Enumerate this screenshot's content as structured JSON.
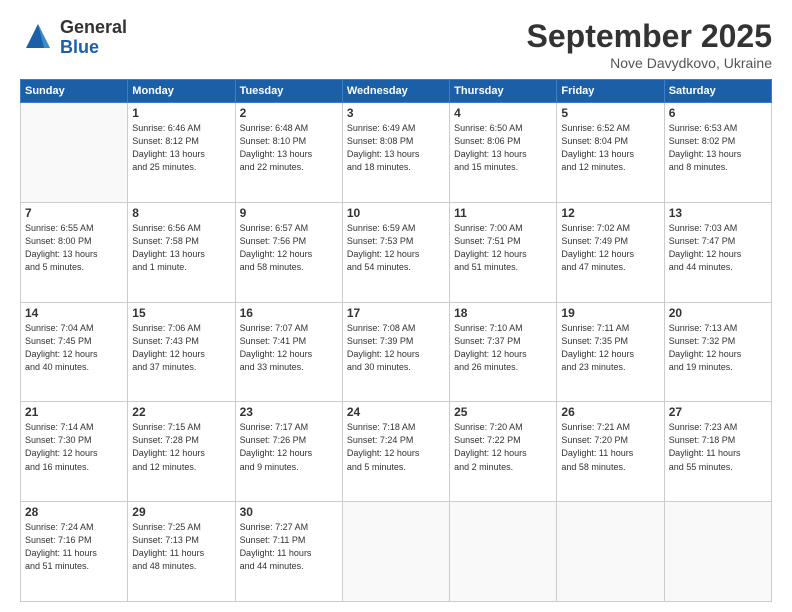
{
  "logo": {
    "general": "General",
    "blue": "Blue"
  },
  "header": {
    "month": "September 2025",
    "location": "Nove Davydkovo, Ukraine"
  },
  "weekdays": [
    "Sunday",
    "Monday",
    "Tuesday",
    "Wednesday",
    "Thursday",
    "Friday",
    "Saturday"
  ],
  "weeks": [
    [
      {
        "day": "",
        "info": ""
      },
      {
        "day": "1",
        "info": "Sunrise: 6:46 AM\nSunset: 8:12 PM\nDaylight: 13 hours\nand 25 minutes."
      },
      {
        "day": "2",
        "info": "Sunrise: 6:48 AM\nSunset: 8:10 PM\nDaylight: 13 hours\nand 22 minutes."
      },
      {
        "day": "3",
        "info": "Sunrise: 6:49 AM\nSunset: 8:08 PM\nDaylight: 13 hours\nand 18 minutes."
      },
      {
        "day": "4",
        "info": "Sunrise: 6:50 AM\nSunset: 8:06 PM\nDaylight: 13 hours\nand 15 minutes."
      },
      {
        "day": "5",
        "info": "Sunrise: 6:52 AM\nSunset: 8:04 PM\nDaylight: 13 hours\nand 12 minutes."
      },
      {
        "day": "6",
        "info": "Sunrise: 6:53 AM\nSunset: 8:02 PM\nDaylight: 13 hours\nand 8 minutes."
      }
    ],
    [
      {
        "day": "7",
        "info": "Sunrise: 6:55 AM\nSunset: 8:00 PM\nDaylight: 13 hours\nand 5 minutes."
      },
      {
        "day": "8",
        "info": "Sunrise: 6:56 AM\nSunset: 7:58 PM\nDaylight: 13 hours\nand 1 minute."
      },
      {
        "day": "9",
        "info": "Sunrise: 6:57 AM\nSunset: 7:56 PM\nDaylight: 12 hours\nand 58 minutes."
      },
      {
        "day": "10",
        "info": "Sunrise: 6:59 AM\nSunset: 7:53 PM\nDaylight: 12 hours\nand 54 minutes."
      },
      {
        "day": "11",
        "info": "Sunrise: 7:00 AM\nSunset: 7:51 PM\nDaylight: 12 hours\nand 51 minutes."
      },
      {
        "day": "12",
        "info": "Sunrise: 7:02 AM\nSunset: 7:49 PM\nDaylight: 12 hours\nand 47 minutes."
      },
      {
        "day": "13",
        "info": "Sunrise: 7:03 AM\nSunset: 7:47 PM\nDaylight: 12 hours\nand 44 minutes."
      }
    ],
    [
      {
        "day": "14",
        "info": "Sunrise: 7:04 AM\nSunset: 7:45 PM\nDaylight: 12 hours\nand 40 minutes."
      },
      {
        "day": "15",
        "info": "Sunrise: 7:06 AM\nSunset: 7:43 PM\nDaylight: 12 hours\nand 37 minutes."
      },
      {
        "day": "16",
        "info": "Sunrise: 7:07 AM\nSunset: 7:41 PM\nDaylight: 12 hours\nand 33 minutes."
      },
      {
        "day": "17",
        "info": "Sunrise: 7:08 AM\nSunset: 7:39 PM\nDaylight: 12 hours\nand 30 minutes."
      },
      {
        "day": "18",
        "info": "Sunrise: 7:10 AM\nSunset: 7:37 PM\nDaylight: 12 hours\nand 26 minutes."
      },
      {
        "day": "19",
        "info": "Sunrise: 7:11 AM\nSunset: 7:35 PM\nDaylight: 12 hours\nand 23 minutes."
      },
      {
        "day": "20",
        "info": "Sunrise: 7:13 AM\nSunset: 7:32 PM\nDaylight: 12 hours\nand 19 minutes."
      }
    ],
    [
      {
        "day": "21",
        "info": "Sunrise: 7:14 AM\nSunset: 7:30 PM\nDaylight: 12 hours\nand 16 minutes."
      },
      {
        "day": "22",
        "info": "Sunrise: 7:15 AM\nSunset: 7:28 PM\nDaylight: 12 hours\nand 12 minutes."
      },
      {
        "day": "23",
        "info": "Sunrise: 7:17 AM\nSunset: 7:26 PM\nDaylight: 12 hours\nand 9 minutes."
      },
      {
        "day": "24",
        "info": "Sunrise: 7:18 AM\nSunset: 7:24 PM\nDaylight: 12 hours\nand 5 minutes."
      },
      {
        "day": "25",
        "info": "Sunrise: 7:20 AM\nSunset: 7:22 PM\nDaylight: 12 hours\nand 2 minutes."
      },
      {
        "day": "26",
        "info": "Sunrise: 7:21 AM\nSunset: 7:20 PM\nDaylight: 11 hours\nand 58 minutes."
      },
      {
        "day": "27",
        "info": "Sunrise: 7:23 AM\nSunset: 7:18 PM\nDaylight: 11 hours\nand 55 minutes."
      }
    ],
    [
      {
        "day": "28",
        "info": "Sunrise: 7:24 AM\nSunset: 7:16 PM\nDaylight: 11 hours\nand 51 minutes."
      },
      {
        "day": "29",
        "info": "Sunrise: 7:25 AM\nSunset: 7:13 PM\nDaylight: 11 hours\nand 48 minutes."
      },
      {
        "day": "30",
        "info": "Sunrise: 7:27 AM\nSunset: 7:11 PM\nDaylight: 11 hours\nand 44 minutes."
      },
      {
        "day": "",
        "info": ""
      },
      {
        "day": "",
        "info": ""
      },
      {
        "day": "",
        "info": ""
      },
      {
        "day": "",
        "info": ""
      }
    ]
  ]
}
